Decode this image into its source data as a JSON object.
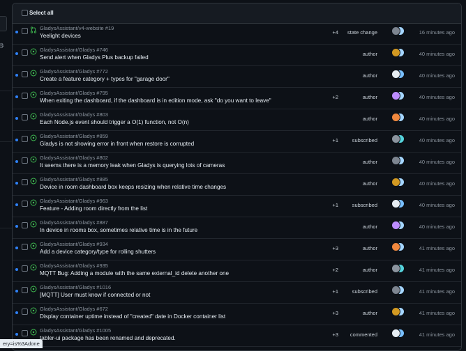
{
  "header": {
    "select_all_label": "Select all"
  },
  "status_bar": {
    "url_text": "ery=is%3Adone"
  },
  "colors": {
    "unread_dot": "#2f81f7",
    "open_icon": "#3fb950",
    "pr_icon": "#3fb950"
  },
  "notifications": [
    {
      "icon": "pull-request-icon",
      "repo": "GladysAssistant/v4-website",
      "number": "#19",
      "title": "Yeelight devices",
      "count": "+4",
      "reason": "state change",
      "time": "16 minutes ago"
    },
    {
      "icon": "issue-open-icon",
      "repo": "GladysAssistant/Gladys",
      "number": "#746",
      "title": "Send alert when Gladys Plus backup failed",
      "count": "",
      "reason": "author",
      "time": "40 minutes ago"
    },
    {
      "icon": "issue-open-icon",
      "repo": "GladysAssistant/Gladys",
      "number": "#772",
      "title": "Create a feature category + types for \"garage door\"",
      "count": "",
      "reason": "author",
      "time": "40 minutes ago"
    },
    {
      "icon": "issue-open-icon",
      "repo": "GladysAssistant/Gladys",
      "number": "#795",
      "title": "When exiting the dashboard, if the dashboard is in edition mode, ask \"do you want to leave\"",
      "count": "+2",
      "reason": "author",
      "time": "40 minutes ago"
    },
    {
      "icon": "issue-open-icon",
      "repo": "GladysAssistant/Gladys",
      "number": "#803",
      "title": "Each Node.js event should trigger a O(1) function, not O(n)",
      "count": "",
      "reason": "author",
      "time": "40 minutes ago"
    },
    {
      "icon": "issue-open-icon",
      "repo": "GladysAssistant/Gladys",
      "number": "#859",
      "title": "Gladys is not showing error in front when restore is corrupted",
      "count": "+1",
      "reason": "subscribed",
      "time": "40 minutes ago"
    },
    {
      "icon": "issue-open-icon",
      "repo": "GladysAssistant/Gladys",
      "number": "#802",
      "title": "It seems there is a memory leak when Gladys is querying lots of cameras",
      "count": "",
      "reason": "author",
      "time": "40 minutes ago"
    },
    {
      "icon": "issue-open-icon",
      "repo": "GladysAssistant/Gladys",
      "number": "#885",
      "title": "Device in room dashboard box keeps resizing when relative time changes",
      "count": "",
      "reason": "author",
      "time": "40 minutes ago"
    },
    {
      "icon": "issue-open-icon",
      "repo": "GladysAssistant/Gladys",
      "number": "#963",
      "title": "Feature - Adding room directly from the list",
      "count": "+1",
      "reason": "subscribed",
      "time": "40 minutes ago"
    },
    {
      "icon": "issue-open-icon",
      "repo": "GladysAssistant/Gladys",
      "number": "#887",
      "title": "In device in rooms box, sometimes relative time is in the future",
      "count": "",
      "reason": "author",
      "time": "40 minutes ago"
    },
    {
      "icon": "issue-open-icon",
      "repo": "GladysAssistant/Gladys",
      "number": "#934",
      "title": "Add a device category/type for rolling shutters",
      "count": "+3",
      "reason": "author",
      "time": "41 minutes ago"
    },
    {
      "icon": "issue-open-icon",
      "repo": "GladysAssistant/Gladys",
      "number": "#935",
      "title": "MQTT Bug: Adding a module with the same external_id delete another one",
      "count": "+2",
      "reason": "author",
      "time": "41 minutes ago"
    },
    {
      "icon": "issue-open-icon",
      "repo": "GladysAssistant/Gladys",
      "number": "#1016",
      "title": "[MQTT] User must know if connected or not",
      "count": "+1",
      "reason": "subscribed",
      "time": "41 minutes ago"
    },
    {
      "icon": "issue-open-icon",
      "repo": "GladysAssistant/Gladys",
      "number": "#672",
      "title": "Display container uptime instead of \"created\" date in Docker container list",
      "count": "+3",
      "reason": "author",
      "time": "41 minutes ago"
    },
    {
      "icon": "issue-open-icon",
      "repo": "GladysAssistant/Gladys",
      "number": "#1005",
      "title": "tabler-ui package has been renamed and deprecated.",
      "count": "+3",
      "reason": "commented",
      "time": "41 minutes ago"
    }
  ]
}
